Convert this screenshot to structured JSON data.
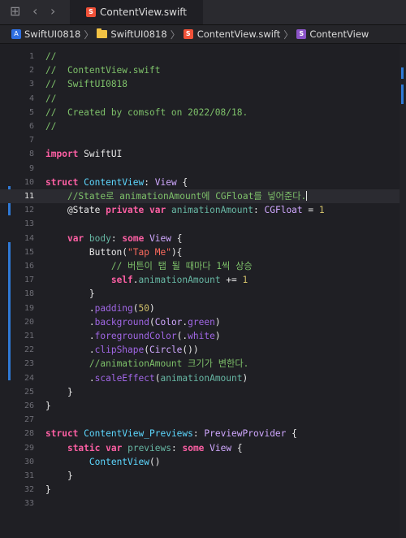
{
  "tab": {
    "title": "ContentView.swift"
  },
  "breadcrumb": {
    "project": "SwiftUI0818",
    "folder": "SwiftUI0818",
    "file": "ContentView.swift",
    "symbol": "ContentView"
  },
  "lines": [
    {
      "n": "1",
      "segs": [
        [
          "cmt",
          "//"
        ]
      ]
    },
    {
      "n": "2",
      "segs": [
        [
          "cmt",
          "//  ContentView.swift"
        ]
      ]
    },
    {
      "n": "3",
      "segs": [
        [
          "cmt",
          "//  SwiftUI0818"
        ]
      ]
    },
    {
      "n": "4",
      "segs": [
        [
          "cmt",
          "//"
        ]
      ]
    },
    {
      "n": "5",
      "segs": [
        [
          "cmt",
          "//  Created by comsoft on 2022/08/18."
        ]
      ]
    },
    {
      "n": "6",
      "segs": [
        [
          "cmt",
          "//"
        ]
      ]
    },
    {
      "n": "7",
      "segs": []
    },
    {
      "n": "8",
      "segs": [
        [
          "kw",
          "import"
        ],
        [
          "plain",
          " SwiftUI"
        ]
      ]
    },
    {
      "n": "9",
      "segs": []
    },
    {
      "n": "10",
      "segs": [
        [
          "kw",
          "struct"
        ],
        [
          "plain",
          " "
        ],
        [
          "tyd",
          "ContentView"
        ],
        [
          "plain",
          ": "
        ],
        [
          "ty",
          "View"
        ],
        [
          "plain",
          " {"
        ]
      ]
    },
    {
      "n": "11",
      "active": true,
      "segs": [
        [
          "plain",
          "    "
        ],
        [
          "cmt",
          "//State로 animationAmount에 CGFloat를 넣어준다."
        ]
      ]
    },
    {
      "n": "12",
      "segs": [
        [
          "plain",
          "    @State "
        ],
        [
          "kw",
          "private"
        ],
        [
          "plain",
          " "
        ],
        [
          "kw",
          "var"
        ],
        [
          "plain",
          " "
        ],
        [
          "fn",
          "animationAmount"
        ],
        [
          "plain",
          ": "
        ],
        [
          "ty",
          "CGFloat"
        ],
        [
          "plain",
          " = "
        ],
        [
          "num",
          "1"
        ]
      ]
    },
    {
      "n": "13",
      "segs": []
    },
    {
      "n": "14",
      "segs": [
        [
          "plain",
          "    "
        ],
        [
          "kw",
          "var"
        ],
        [
          "plain",
          " "
        ],
        [
          "fn",
          "body"
        ],
        [
          "plain",
          ": "
        ],
        [
          "kw",
          "some"
        ],
        [
          "plain",
          " "
        ],
        [
          "ty",
          "View"
        ],
        [
          "plain",
          " {"
        ]
      ]
    },
    {
      "n": "15",
      "segs": [
        [
          "plain",
          "        Button("
        ],
        [
          "str",
          "\"Tap Me\""
        ],
        [
          "plain",
          "){"
        ]
      ]
    },
    {
      "n": "16",
      "segs": [
        [
          "plain",
          "            "
        ],
        [
          "cmt",
          "// 버튼이 탭 될 때마다 1씩 상승"
        ]
      ]
    },
    {
      "n": "17",
      "segs": [
        [
          "plain",
          "            "
        ],
        [
          "kw",
          "self"
        ],
        [
          "plain",
          "."
        ],
        [
          "prop",
          "animationAmount"
        ],
        [
          "plain",
          " += "
        ],
        [
          "num",
          "1"
        ]
      ]
    },
    {
      "n": "18",
      "segs": [
        [
          "plain",
          "        }"
        ]
      ]
    },
    {
      "n": "19",
      "segs": [
        [
          "plain",
          "        ."
        ],
        [
          "fn2",
          "padding"
        ],
        [
          "plain",
          "("
        ],
        [
          "num",
          "50"
        ],
        [
          "plain",
          ")"
        ]
      ]
    },
    {
      "n": "20",
      "segs": [
        [
          "plain",
          "        ."
        ],
        [
          "fn2",
          "background"
        ],
        [
          "plain",
          "("
        ],
        [
          "ty",
          "Color"
        ],
        [
          "plain",
          "."
        ],
        [
          "fn2",
          "green"
        ],
        [
          "plain",
          ")"
        ]
      ]
    },
    {
      "n": "21",
      "segs": [
        [
          "plain",
          "        ."
        ],
        [
          "fn2",
          "foregroundColor"
        ],
        [
          "plain",
          "(."
        ],
        [
          "fn2",
          "white"
        ],
        [
          "plain",
          ")"
        ]
      ]
    },
    {
      "n": "22",
      "segs": [
        [
          "plain",
          "        ."
        ],
        [
          "fn2",
          "clipShape"
        ],
        [
          "plain",
          "("
        ],
        [
          "ty",
          "Circle"
        ],
        [
          "plain",
          "())"
        ]
      ]
    },
    {
      "n": "23",
      "segs": [
        [
          "plain",
          "        "
        ],
        [
          "cmt",
          "//animationAmount 크기가 변한다."
        ]
      ]
    },
    {
      "n": "24",
      "segs": [
        [
          "plain",
          "        ."
        ],
        [
          "fn2",
          "scaleEffect"
        ],
        [
          "plain",
          "("
        ],
        [
          "prop",
          "animationAmount"
        ],
        [
          "plain",
          ")"
        ]
      ]
    },
    {
      "n": "25",
      "segs": [
        [
          "plain",
          "    }"
        ]
      ]
    },
    {
      "n": "26",
      "segs": [
        [
          "plain",
          "}"
        ]
      ]
    },
    {
      "n": "27",
      "segs": []
    },
    {
      "n": "28",
      "segs": [
        [
          "kw",
          "struct"
        ],
        [
          "plain",
          " "
        ],
        [
          "tyd",
          "ContentView_Previews"
        ],
        [
          "plain",
          ": "
        ],
        [
          "ty",
          "PreviewProvider"
        ],
        [
          "plain",
          " {"
        ]
      ]
    },
    {
      "n": "29",
      "segs": [
        [
          "plain",
          "    "
        ],
        [
          "kw",
          "static"
        ],
        [
          "plain",
          " "
        ],
        [
          "kw",
          "var"
        ],
        [
          "plain",
          " "
        ],
        [
          "fn",
          "previews"
        ],
        [
          "plain",
          ": "
        ],
        [
          "kw",
          "some"
        ],
        [
          "plain",
          " "
        ],
        [
          "ty",
          "View"
        ],
        [
          "plain",
          " {"
        ]
      ]
    },
    {
      "n": "30",
      "segs": [
        [
          "plain",
          "        "
        ],
        [
          "tyd",
          "ContentView"
        ],
        [
          "plain",
          "()"
        ]
      ]
    },
    {
      "n": "31",
      "segs": [
        [
          "plain",
          "    }"
        ]
      ]
    },
    {
      "n": "32",
      "segs": [
        [
          "plain",
          "}"
        ]
      ]
    },
    {
      "n": "33",
      "segs": []
    }
  ],
  "colors": {
    "accent": "#2f7ad6",
    "swift_badge": "#f05138"
  }
}
